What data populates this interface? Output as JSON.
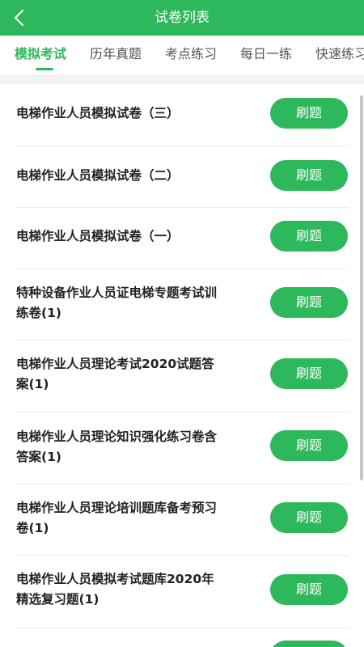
{
  "header": {
    "title": "试卷列表",
    "back_icon": "chevron-left-icon"
  },
  "tabs": [
    {
      "label": "模拟考试",
      "active": true
    },
    {
      "label": "历年真题",
      "active": false
    },
    {
      "label": "考点练习",
      "active": false
    },
    {
      "label": "每日一练",
      "active": false
    },
    {
      "label": "快速练习",
      "active": false
    }
  ],
  "papers": [
    {
      "title": "电梯作业人员模拟试卷（三）",
      "action": "刷题"
    },
    {
      "title": "电梯作业人员模拟试卷（二）",
      "action": "刷题"
    },
    {
      "title": "电梯作业人员模拟试卷（一）",
      "action": "刷题"
    },
    {
      "title": "特种设备作业人员证电梯专题考试训练卷(1)",
      "action": "刷题"
    },
    {
      "title": "电梯作业人员理论考试2020试题答案(1)",
      "action": "刷题"
    },
    {
      "title": "电梯作业人员理论知识强化练习卷含答案(1)",
      "action": "刷题"
    },
    {
      "title": "电梯作业人员理论培训题库备考预习卷(1)",
      "action": "刷题"
    },
    {
      "title": "电梯作业人员模拟考试题库2020年精选复习题(1)",
      "action": "刷题"
    }
  ],
  "colors": {
    "brand": "#2eb85c",
    "text": "#222222",
    "tab_inactive": "#555555"
  }
}
